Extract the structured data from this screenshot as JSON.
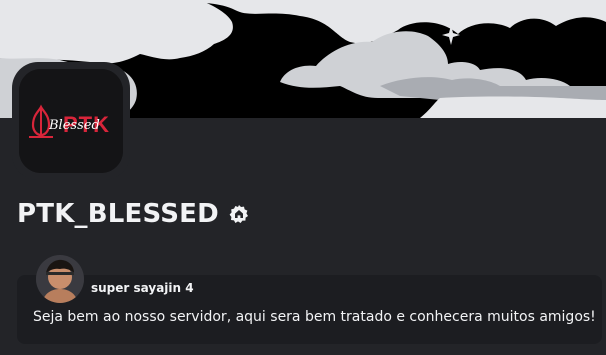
{
  "server": {
    "name": "PTK_BLESSED",
    "logo_text": "PTK",
    "logo_script": "Blessed",
    "badge_icon": "home-icon"
  },
  "welcome": {
    "author": "super sayajin 4",
    "message": "Seja bem ao nosso servidor, aqui sera bem tratado e conhecera muitos amigos!"
  },
  "colors": {
    "background": "#232428",
    "message_bg": "#1c1d21",
    "text": "#f2f3f5",
    "logo_red": "#d8253a"
  }
}
